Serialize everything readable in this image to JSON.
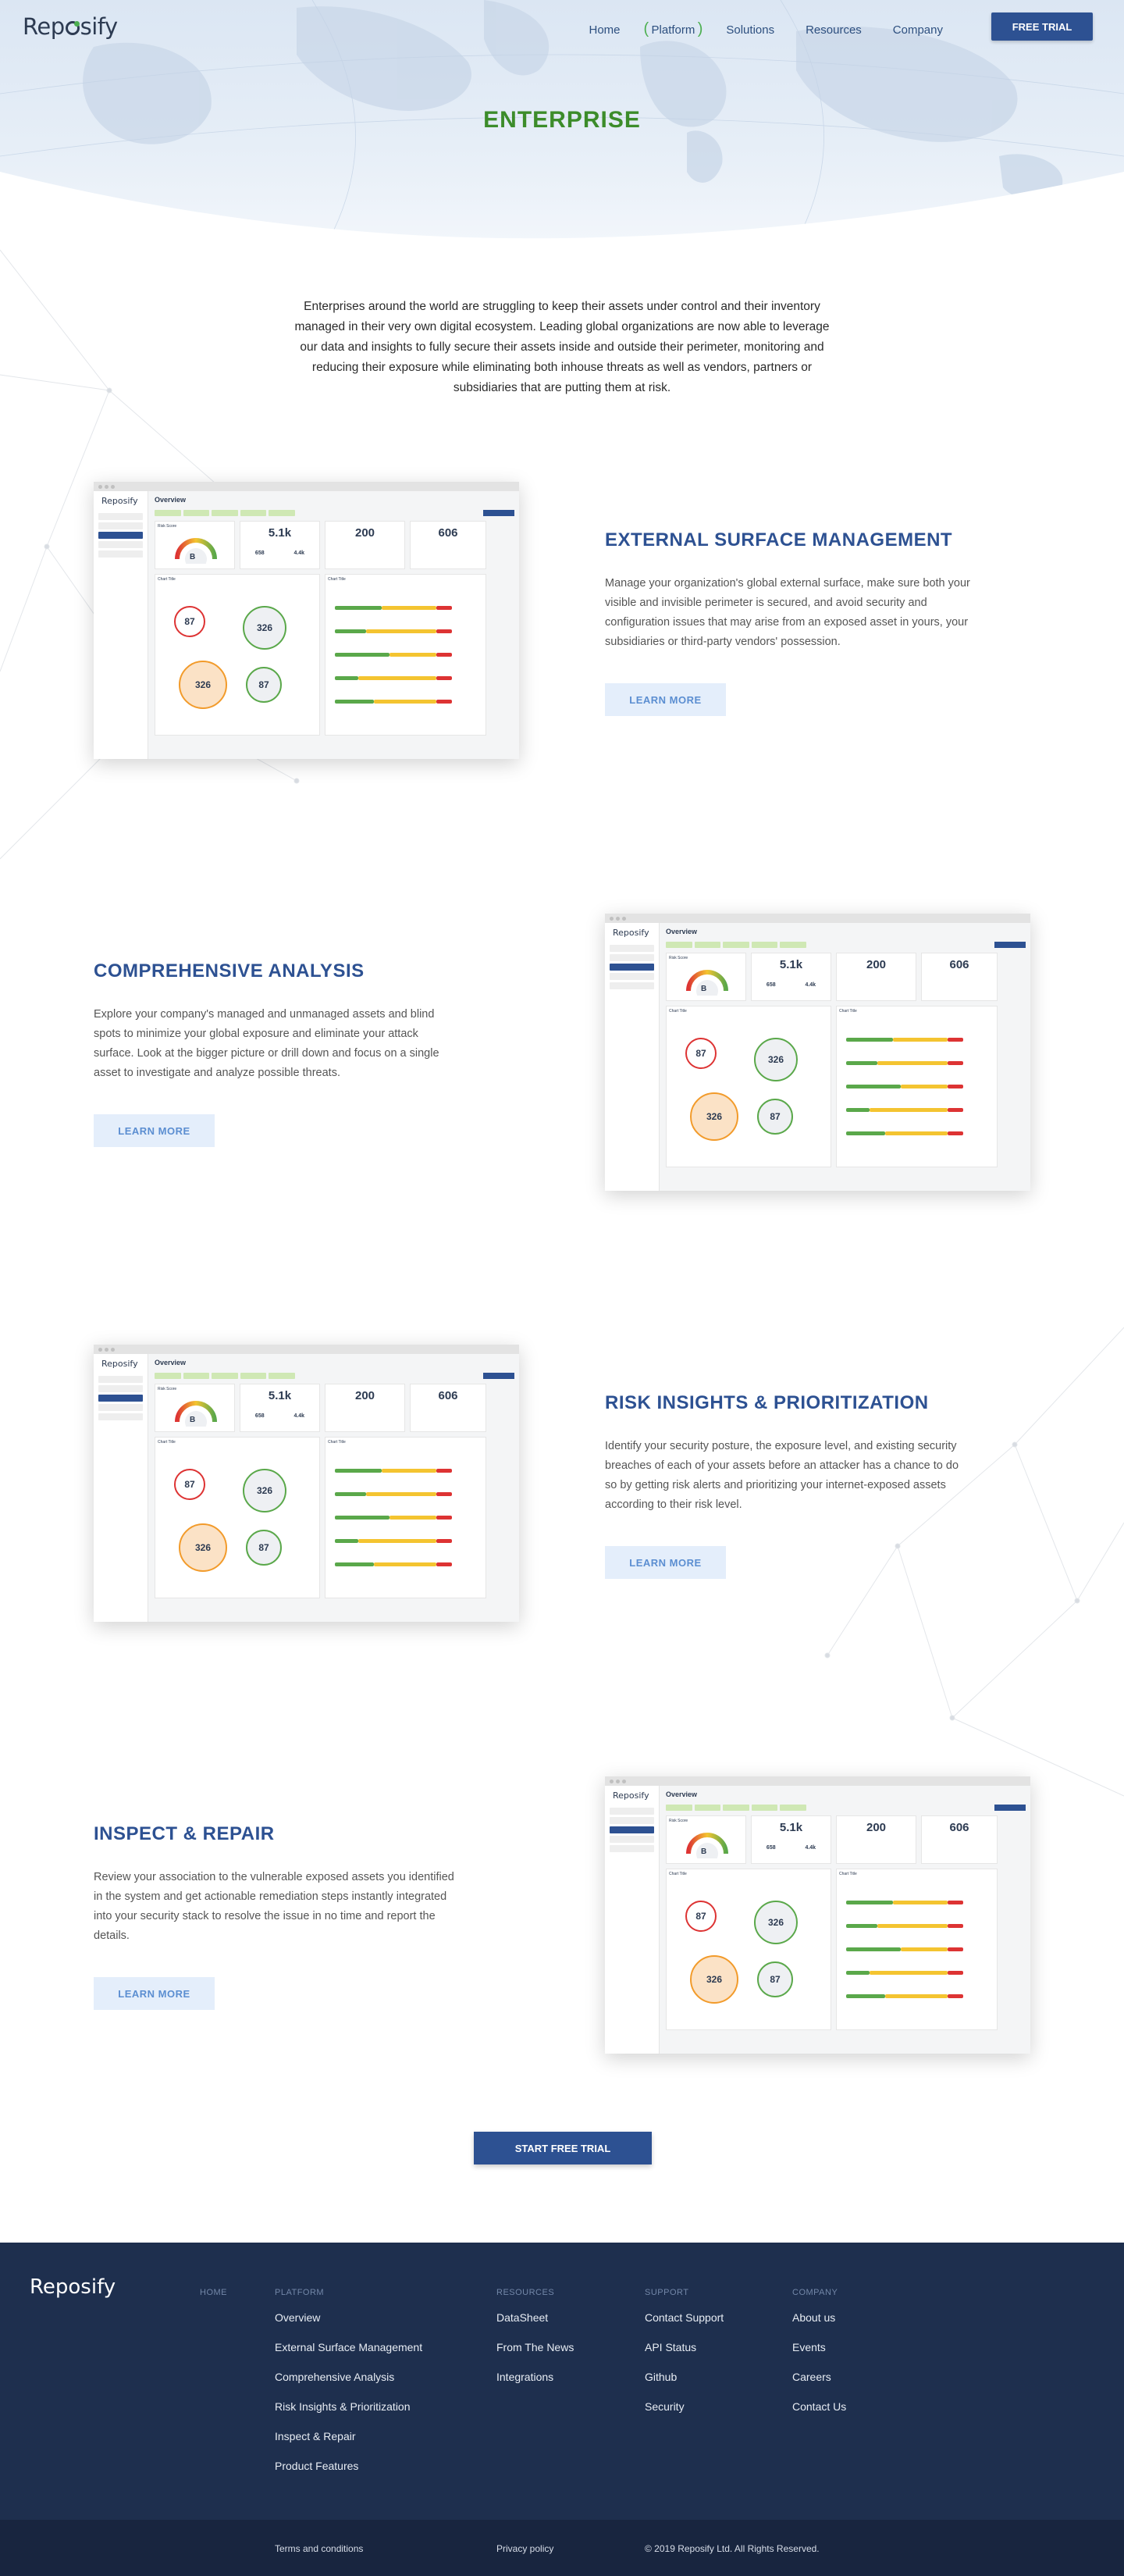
{
  "brand": {
    "name": "Reposify"
  },
  "nav": {
    "items": [
      "Home",
      "Platform",
      "Solutions",
      "Resources",
      "Company"
    ],
    "cta": "FREE TRIAL"
  },
  "hero": {
    "title": "ENTERPRISE"
  },
  "intro": "Enterprises around the world are struggling to keep their assets under control and their inventory managed in their very own digital ecosystem. Leading global organizations are now able to leverage our data and insights to fully secure their assets inside and outside their perimeter, monitoring and reducing their exposure while eliminating both inhouse threats as well as vendors, partners or subsidiaries that are putting them at risk.",
  "sections": [
    {
      "title": "EXTERNAL SURFACE MANAGEMENT",
      "body": "Manage your organization's global external surface, make sure both your visible and invisible perimeter is secured, and avoid security and configuration issues that may arise from an exposed asset in yours, your subsidiaries or third-party vendors' possession.",
      "cta": "LEARN MORE"
    },
    {
      "title": "COMPREHENSIVE ANALYSIS",
      "body": "Explore your company's managed and unmanaged assets and blind spots to minimize your global exposure and eliminate your attack surface. Look at the bigger picture or drill down and focus on a single asset to investigate and analyze possible threats.",
      "cta": "LEARN MORE"
    },
    {
      "title": "RISK INSIGHTS & PRIORITIZATION",
      "body": "Identify your security posture, the exposure level, and existing security breaches of each of your assets before an attacker has a chance to do so by getting risk alerts and prioritizing your internet-exposed assets according to their risk level.",
      "cta": "LEARN MORE"
    },
    {
      "title": "INSPECT & REPAIR",
      "body": "Review your association to the vulnerable exposed assets you identified in the system and get actionable remediation steps instantly integrated into your security stack to resolve the issue in no time and report the details.",
      "cta": "LEARN MORE"
    }
  ],
  "dashboard": {
    "logo": "Reposify",
    "title": "Overview",
    "risk_label": "Risk Score",
    "risk_value": "B",
    "stat1": "5.1k",
    "stat2": "200",
    "stat3": "606",
    "sub1": "658",
    "sub2": "4.4k",
    "chart_title": "Chart Title",
    "bubbles": [
      "87",
      "326",
      "326",
      "87"
    ]
  },
  "cta": "START FREE TRIAL",
  "footer": {
    "home": "HOME",
    "platform": {
      "heading": "PLATFORM",
      "links": [
        "Overview",
        "External Surface Management",
        "Comprehensive Analysis",
        "Risk Insights & Prioritization",
        "Inspect & Repair",
        "Product Features"
      ]
    },
    "resources": {
      "heading": "RESOURCES",
      "links": [
        "DataSheet",
        "From The News",
        "Integrations"
      ]
    },
    "support": {
      "heading": "SUPPORT",
      "links": [
        "Contact Support",
        "API Status",
        "Github",
        "Security"
      ]
    },
    "company": {
      "heading": "COMPANY",
      "links": [
        "About us",
        "Events",
        "Careers",
        "Contact Us"
      ]
    },
    "bottom": {
      "terms": "Terms and conditions",
      "privacy": "Privacy policy",
      "copyright": "© 2019 Reposify Ltd. All Rights Reserved."
    }
  }
}
